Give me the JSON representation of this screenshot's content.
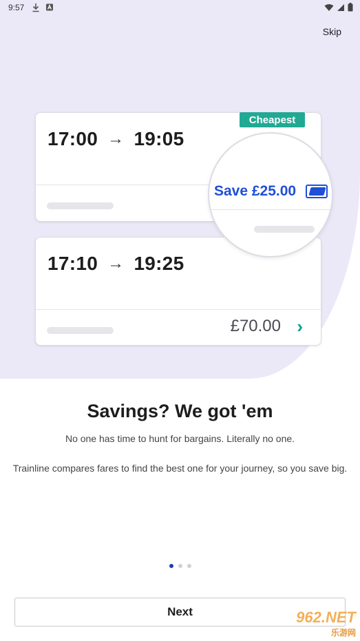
{
  "status_bar": {
    "time": "9:57"
  },
  "header": {
    "skip_label": "Skip"
  },
  "illustration": {
    "badge_label": "Cheapest",
    "journey_1": {
      "depart": "17:00",
      "arrive": "19:05"
    },
    "journey_2": {
      "depart": "17:10",
      "arrive": "19:25",
      "price": "£70.00"
    },
    "save_label": "Save £25.00",
    "arrow": "→",
    "chevron": "›"
  },
  "content": {
    "headline": "Savings? We got 'em",
    "line_1": "No one has time to hunt for bargains. Literally no one.",
    "line_2": "Trainline compares fares to find the best one for your journey, so you save big."
  },
  "pager": {
    "total": 3,
    "current": 1
  },
  "footer": {
    "next_label": "Next"
  },
  "watermark": {
    "brand": "962.NET",
    "sub": "乐游网"
  },
  "colors": {
    "hero_bg": "#ebe9f8",
    "accent_teal": "#21a993",
    "save_blue": "#1f4fd8",
    "dot_active": "#1f3ea8"
  }
}
